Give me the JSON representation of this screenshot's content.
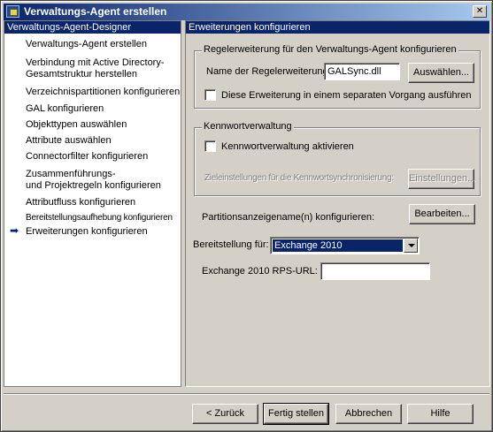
{
  "window": {
    "title": "Verwaltungs-Agent erstellen",
    "close_glyph": "✕"
  },
  "nav": {
    "header": "Verwaltungs-Agent-Designer",
    "current_marker": "➡",
    "items": [
      {
        "label": "Verwaltungs-Agent erstellen"
      },
      {
        "label": "Verbindung mit Active Directory-",
        "label2": "Gesamtstruktur herstellen"
      },
      {
        "label": "Verzeichnispartitionen konfigurieren"
      },
      {
        "label": "GAL konfigurieren"
      },
      {
        "label": "Objekttypen auswählen"
      },
      {
        "label": "Attribute auswählen"
      },
      {
        "label": "Connectorfilter konfigurieren"
      },
      {
        "label": "Zusammenführungs-",
        "label2": "und Projektregeln konfigurieren"
      },
      {
        "label": "Attributfluss konfigurieren"
      },
      {
        "label": "Bereitstellungsaufhebung konfigurieren"
      },
      {
        "label": "Erweiterungen konfigurieren"
      }
    ]
  },
  "panel": {
    "header": "Erweiterungen konfigurieren",
    "rules": {
      "group_title": "Regelerweiterung für den Verwaltungs-Agent konfigurieren",
      "name_label": "Name der Regelerweiterung:",
      "name_value": "GALSync.dll",
      "select_button": "Auswählen...",
      "separate_process_label": "Diese Erweiterung in einem separaten Vorgang ausführen",
      "separate_process_checked": false
    },
    "password": {
      "group_title": "Kennwortverwaltung",
      "enable_label": "Kennwortverwaltung aktivieren",
      "enable_checked": false,
      "target_settings_label": "Zieleinstellungen für die Kennwortsynchronisierung:",
      "settings_button": "Einstellungen..."
    },
    "partition_label": "Partitionsanzeigename(n) konfigurieren:",
    "edit_button": "Bearbeiten...",
    "provisioning_label": "Bereitstellung für:",
    "provisioning_value": "Exchange 2010",
    "rps_label": "Exchange 2010 RPS-URL:",
    "rps_value": ""
  },
  "footer": {
    "back": "< Zurück",
    "finish": "Fertig stellen",
    "cancel": "Abbrechen",
    "help": "Hilfe"
  }
}
